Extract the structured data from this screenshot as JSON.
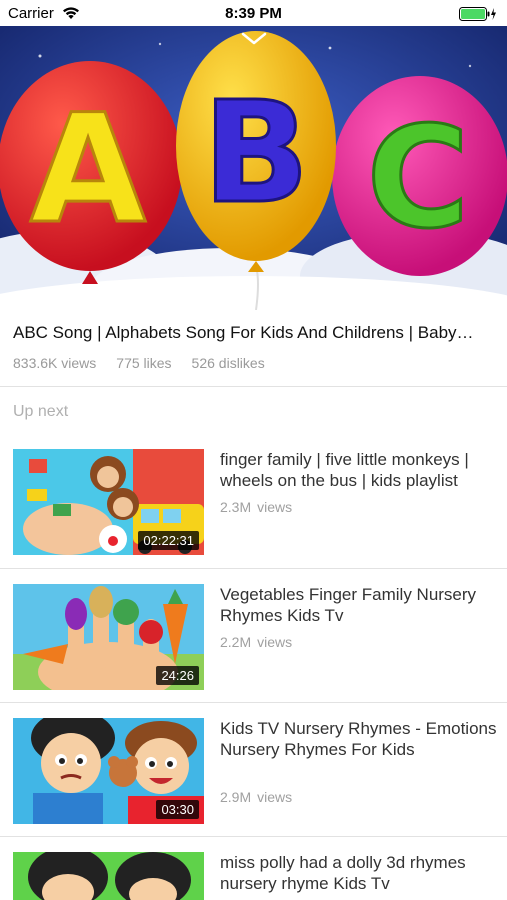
{
  "status_bar": {
    "carrier": "Carrier",
    "time": "8:39 PM",
    "wifi_icon": "wifi-icon",
    "battery_icon": "battery-charging-icon",
    "battery_color": "#4cd964"
  },
  "player": {
    "collapse_icon": "chevron-down-icon",
    "artwork_letters": [
      "A",
      "B",
      "C"
    ],
    "balloon_colors": [
      "#e5192b",
      "#f5b800",
      "#e0138c"
    ]
  },
  "video": {
    "title": "ABC Song | Alphabets Song For Kids And Childrens | Baby…",
    "views": "833.6K views",
    "likes": "775 likes",
    "dislikes": "526 dislikes"
  },
  "up_next_label": "Up next",
  "up_next": [
    {
      "title": "finger family | five little monkeys | wheels on the bus | kids playlist",
      "view_count": "2.3M",
      "views_label": "views",
      "duration": "02:22:31"
    },
    {
      "title": "Vegetables Finger Family Nursery Rhymes Kids Tv",
      "view_count": "2.2M",
      "views_label": "views",
      "duration": "24:26"
    },
    {
      "title": "Kids TV Nursery Rhymes - Emotions Nursery Rhymes For Kids",
      "view_count": "2.9M",
      "views_label": "views",
      "duration": "03:30"
    },
    {
      "title": "miss polly had a dolly 3d rhymes nursery rhyme Kids Tv",
      "view_count": "",
      "views_label": "",
      "duration": ""
    }
  ]
}
